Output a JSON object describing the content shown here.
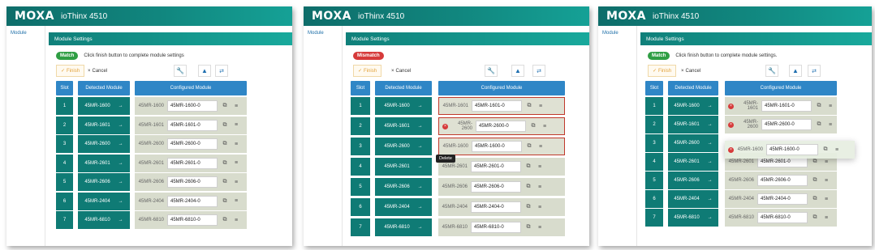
{
  "app": {
    "logo": "MOXA",
    "product": "ioThinx 4510",
    "sidebar_item": "Module",
    "section_title": "Module Settings"
  },
  "toolbar": {
    "finish": "Finish",
    "cancel": "Cancel"
  },
  "grid": {
    "slot_header": "Slot",
    "detected_header": "Detected Module",
    "configured_header": "Configured Module"
  },
  "panels": [
    {
      "status_badge": "Match",
      "status_text": "Click finish button to complete module settings",
      "rows": [
        {
          "slot": "1",
          "detected": "45MR-1600",
          "config_label": "45MR-1600",
          "config_value": "45MR-1600-0"
        },
        {
          "slot": "2",
          "detected": "45MR-1601",
          "config_label": "45MR-1601",
          "config_value": "45MR-1601-0"
        },
        {
          "slot": "3",
          "detected": "45MR-2600",
          "config_label": "45MR-2600",
          "config_value": "45MR-2600-0"
        },
        {
          "slot": "4",
          "detected": "45MR-2601",
          "config_label": "45MR-2601",
          "config_value": "45MR-2601-0"
        },
        {
          "slot": "5",
          "detected": "45MR-2606",
          "config_label": "45MR-2606",
          "config_value": "45MR-2606-0"
        },
        {
          "slot": "6",
          "detected": "45MR-2404",
          "config_label": "45MR-2404",
          "config_value": "45MR-2404-0"
        },
        {
          "slot": "7",
          "detected": "45MR-6810",
          "config_label": "45MR-6810",
          "config_value": "45MR-6810-0"
        }
      ]
    },
    {
      "status_badge": "Mismatch",
      "tooltip": "Delete",
      "rows": [
        {
          "slot": "1",
          "detected": "45MR-1600",
          "config_label": "45MR-1601",
          "config_value": "45MR-1601-0"
        },
        {
          "slot": "2",
          "detected": "45MR-1601",
          "config_label": "45MR-2600",
          "config_value": "45MR-2600-0"
        },
        {
          "slot": "3",
          "detected": "45MR-2600",
          "config_label": "45MR-1600",
          "config_value": "45MR-1600-0"
        },
        {
          "slot": "4",
          "detected": "45MR-2601",
          "config_label": "45MR-2601",
          "config_value": "45MR-2601-0"
        },
        {
          "slot": "5",
          "detected": "45MR-2606",
          "config_label": "45MR-2606",
          "config_value": "45MR-2606-0"
        },
        {
          "slot": "6",
          "detected": "45MR-2404",
          "config_label": "45MR-2404",
          "config_value": "45MR-2404-0"
        },
        {
          "slot": "7",
          "detected": "45MR-6810",
          "config_label": "45MR-6810",
          "config_value": "45MR-6810-0"
        }
      ]
    },
    {
      "status_badge": "Match",
      "status_text": "Click finish button to complete module settings.",
      "rows": [
        {
          "slot": "1",
          "detected": "45MR-1600",
          "config_label": "45MR-1601",
          "config_value": "45MR-1601-0"
        },
        {
          "slot": "2",
          "detected": "45MR-1601",
          "config_label": "45MR-2600",
          "config_value": "45MR-2600-0"
        },
        {
          "slot": "3",
          "detected": "45MR-2600",
          "config_label": "",
          "config_value": ""
        },
        {
          "slot": "4",
          "detected": "45MR-2601",
          "config_label": "45MR-2601",
          "config_value": "45MR-2601-0"
        },
        {
          "slot": "5",
          "detected": "45MR-2606",
          "config_label": "45MR-2606",
          "config_value": "45MR-2606-0"
        },
        {
          "slot": "6",
          "detected": "45MR-2404",
          "config_label": "45MR-2404",
          "config_value": "45MR-2404-0"
        },
        {
          "slot": "7",
          "detected": "45MR-6810",
          "config_label": "45MR-6810",
          "config_value": "45MR-6810-0"
        }
      ],
      "drag_ghost": {
        "label": "45MR-1600",
        "value": "45MR-1600-0"
      }
    }
  ],
  "colors": {
    "teal": "#0f7b75",
    "header_blue": "#2f86c6",
    "error_red": "#d63a3a",
    "match_green": "#2f9e44",
    "config_bg": "#d8dccd"
  }
}
